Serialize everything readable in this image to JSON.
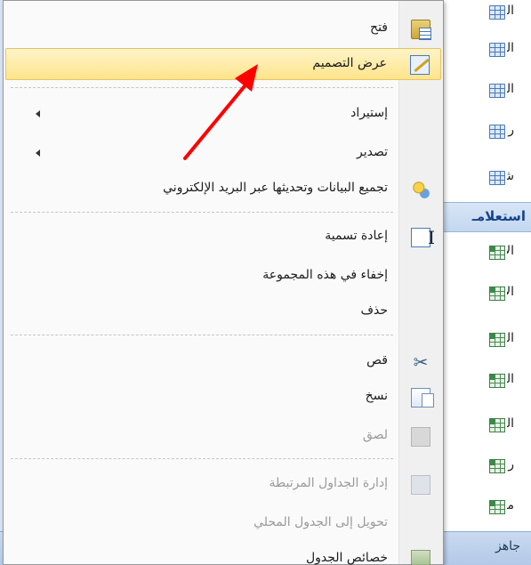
{
  "nav_pane": {
    "tables": [
      {
        "text": "المـ"
      },
      {
        "text": "المـ"
      },
      {
        "text": "المـ"
      },
      {
        "text": "رواتـ"
      },
      {
        "text": "شعـ"
      }
    ],
    "group_header": "استعلامـ",
    "queries": [
      {
        "text": "الأسـ"
      },
      {
        "text": "الأسـ"
      },
      {
        "text": "الكـ"
      },
      {
        "text": "المـ"
      },
      {
        "text": "المـ"
      },
      {
        "text": "رواتـ"
      },
      {
        "text": "مرتـ"
      }
    ]
  },
  "status_bar": {
    "text": "جاهز"
  },
  "context_menu": {
    "items": [
      {
        "label": "فتح",
        "icon": "open-icon",
        "enabled": true
      },
      {
        "label": "عرض التصميم",
        "icon": "design-view-icon",
        "enabled": true,
        "highlighted": true
      },
      {
        "label": "إستيراد",
        "submenu": true,
        "enabled": true
      },
      {
        "label": "تصدير",
        "submenu": true,
        "enabled": true
      },
      {
        "label": "تجميع البيانات وتحديثها عبر البريد الإلكتروني",
        "icon": "collect-data-icon",
        "enabled": true
      },
      {
        "label": "إعادة تسمية",
        "icon": "rename-icon",
        "enabled": true
      },
      {
        "label": "إخفاء في هذه المجموعة",
        "enabled": true
      },
      {
        "label": "حذف",
        "enabled": true
      },
      {
        "label": "قص",
        "icon": "cut-icon",
        "enabled": true
      },
      {
        "label": "نسخ",
        "icon": "copy-icon",
        "enabled": true
      },
      {
        "label": "لصق",
        "icon": "paste-icon",
        "enabled": false
      },
      {
        "label": "إدارة الجداول المرتبطة",
        "icon": "linked-table-manager-icon",
        "enabled": false
      },
      {
        "label": "تحويل إلى الجدول المحلي",
        "enabled": false
      },
      {
        "label": "خصائص الجدول",
        "icon": "table-properties-icon",
        "enabled": true
      }
    ]
  },
  "colors": {
    "highlight_top": "#fff4c8",
    "highlight_bottom": "#fde48c",
    "annotation_arrow": "#ff0000",
    "nav_group_text": "#15428b"
  }
}
